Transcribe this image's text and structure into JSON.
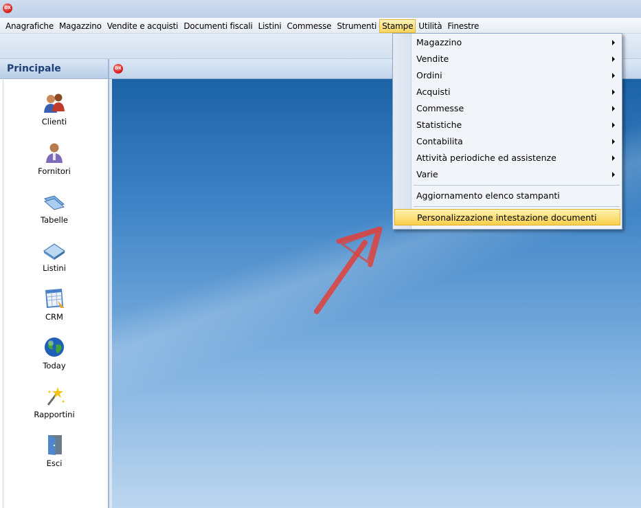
{
  "app": {
    "icon_text": "DX"
  },
  "menubar": {
    "items": [
      "Anagrafiche",
      "Magazzino",
      "Vendite e acquisti",
      "Documenti fiscali",
      "Listini",
      "Commesse",
      "Strumenti",
      "Stampe",
      "Utilità",
      "Finestre"
    ],
    "active": "Stampe"
  },
  "sidebar": {
    "title": "Principale",
    "items": [
      {
        "label": "Clienti",
        "icon": "clients-icon"
      },
      {
        "label": "Fornitori",
        "icon": "suppliers-icon"
      },
      {
        "label": "Tabelle",
        "icon": "tables-icon"
      },
      {
        "label": "Listini",
        "icon": "price-lists-icon"
      },
      {
        "label": "CRM",
        "icon": "calendar-icon"
      },
      {
        "label": "Today",
        "icon": "globe-icon"
      },
      {
        "label": "Rapportini",
        "icon": "magic-wand-icon"
      },
      {
        "label": "Esci",
        "icon": "exit-door-icon"
      }
    ]
  },
  "dropdown": {
    "items": [
      {
        "label": "Magazzino",
        "submenu": true
      },
      {
        "label": "Vendite",
        "submenu": true
      },
      {
        "label": "Ordini",
        "submenu": true
      },
      {
        "label": "Acquisti",
        "submenu": true
      },
      {
        "label": "Commesse",
        "submenu": true
      },
      {
        "label": "Statistiche",
        "submenu": true
      },
      {
        "label": "Contabilita",
        "submenu": true
      },
      {
        "label": "Attività periodiche ed assistenze",
        "submenu": true
      },
      {
        "label": "Varie",
        "submenu": true
      },
      {
        "label": "Aggiornamento elenco stampanti",
        "submenu": false
      },
      {
        "label": "Personalizzazione intestazione documenti",
        "submenu": false,
        "highlighted": true
      }
    ]
  },
  "colors": {
    "highlight": "#f8cf4a",
    "annotation_arrow": "#e0403a",
    "desktop_top": "#1c63a6",
    "desktop_bottom": "#bcd6ef"
  }
}
